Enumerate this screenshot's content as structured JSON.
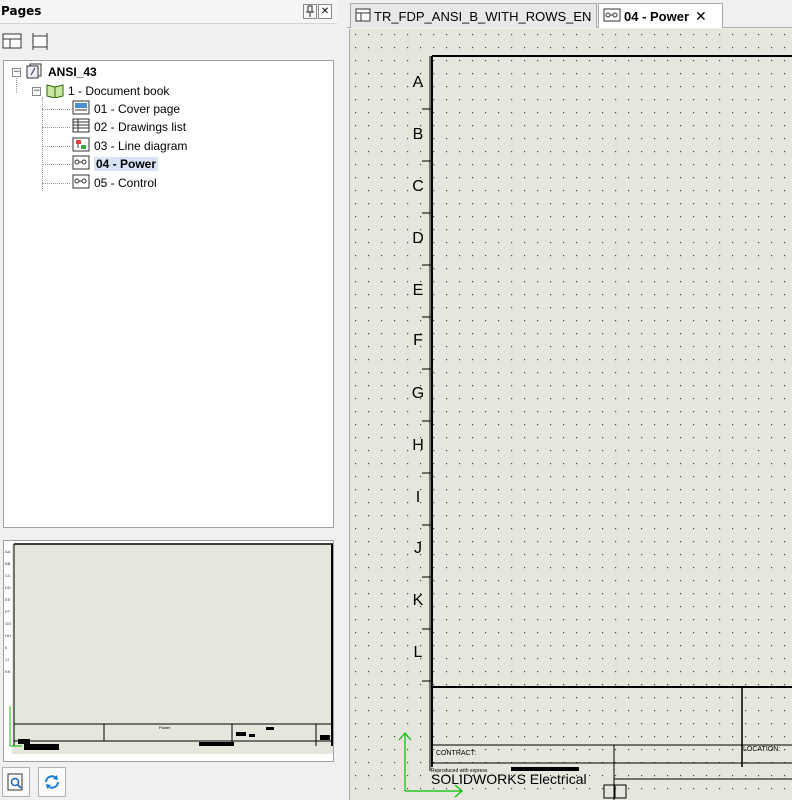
{
  "pages_panel": {
    "title": "Pages",
    "pin_icon": "pin-icon",
    "close_icon": "close-icon"
  },
  "toolbar": {
    "buttons": [
      "page-properties-icon",
      "print-frame-icon"
    ]
  },
  "tree": {
    "root": "ANSI_43",
    "book": "1 - Document book",
    "pages": [
      {
        "label": "01 - Cover page",
        "icon": "cover-page-icon"
      },
      {
        "label": "02 - Drawings list",
        "icon": "drawings-list-icon"
      },
      {
        "label": "03 - Line diagram",
        "icon": "line-diagram-icon"
      },
      {
        "label": "04 - Power",
        "icon": "schematic-icon",
        "selected": true
      },
      {
        "label": "05 - Control",
        "icon": "schematic-icon"
      }
    ]
  },
  "bottom_toolbar": {
    "buttons": [
      "zoom-preview-icon",
      "refresh-icon"
    ]
  },
  "tabs": [
    {
      "label": "TR_FDP_ANSI_B_WITH_ROWS_EN",
      "active": false
    },
    {
      "label": "04 - Power",
      "active": true
    }
  ],
  "drawing": {
    "row_letters": [
      "A",
      "B",
      "C",
      "D",
      "E",
      "F",
      "G",
      "H",
      "I",
      "J",
      "K",
      "L"
    ],
    "contract_label": "CONTRACT:",
    "location_label": "LOCATION:",
    "brand": "SOLIDWORKS Electrical",
    "fine_print": "Reproduced with express"
  },
  "colors": {
    "canvas_bg": "#e6e6dc",
    "selection": "#d7e4f5",
    "axis_green": "#00c000"
  }
}
